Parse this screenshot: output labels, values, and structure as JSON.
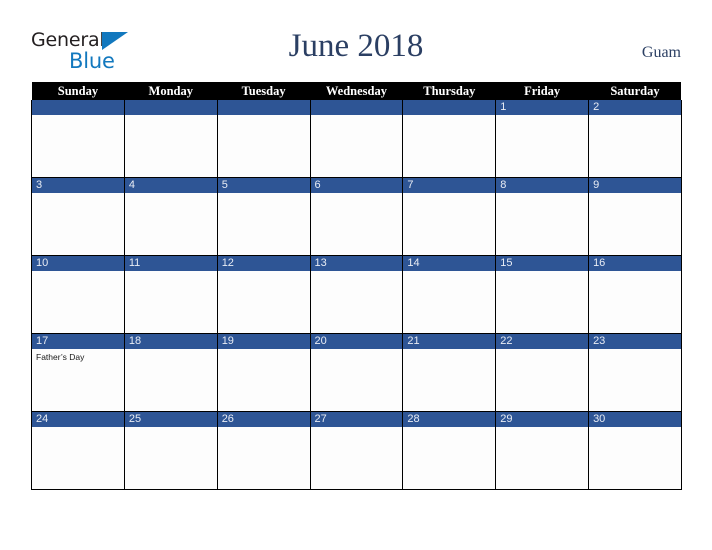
{
  "brand": {
    "word_one": "General",
    "word_two": "Blue",
    "triangle_color": "#1278be",
    "word_one_color": "#231f20",
    "word_two_color": "#1278be"
  },
  "header": {
    "title": "June 2018",
    "locale": "Guam",
    "title_color": "#2b3f63"
  },
  "calendar": {
    "weekday_headers": [
      "Sunday",
      "Monday",
      "Tuesday",
      "Wednesday",
      "Thursday",
      "Friday",
      "Saturday"
    ],
    "header_bg": "#000000",
    "header_text_color": "#ffffff",
    "date_bar_color": "#2e5595",
    "date_text_color": "#e8ecf4",
    "cell_bg": "#fdfdfd",
    "border_color": "#000000",
    "weeks": [
      [
        {
          "date": "",
          "events": []
        },
        {
          "date": "",
          "events": []
        },
        {
          "date": "",
          "events": []
        },
        {
          "date": "",
          "events": []
        },
        {
          "date": "",
          "events": []
        },
        {
          "date": "1",
          "events": []
        },
        {
          "date": "2",
          "events": []
        }
      ],
      [
        {
          "date": "3",
          "events": []
        },
        {
          "date": "4",
          "events": []
        },
        {
          "date": "5",
          "events": []
        },
        {
          "date": "6",
          "events": []
        },
        {
          "date": "7",
          "events": []
        },
        {
          "date": "8",
          "events": []
        },
        {
          "date": "9",
          "events": []
        }
      ],
      [
        {
          "date": "10",
          "events": []
        },
        {
          "date": "11",
          "events": []
        },
        {
          "date": "12",
          "events": []
        },
        {
          "date": "13",
          "events": []
        },
        {
          "date": "14",
          "events": []
        },
        {
          "date": "15",
          "events": []
        },
        {
          "date": "16",
          "events": []
        }
      ],
      [
        {
          "date": "17",
          "events": [
            "Father’s Day"
          ]
        },
        {
          "date": "18",
          "events": []
        },
        {
          "date": "19",
          "events": []
        },
        {
          "date": "20",
          "events": []
        },
        {
          "date": "21",
          "events": []
        },
        {
          "date": "22",
          "events": []
        },
        {
          "date": "23",
          "events": []
        }
      ],
      [
        {
          "date": "24",
          "events": []
        },
        {
          "date": "25",
          "events": []
        },
        {
          "date": "26",
          "events": []
        },
        {
          "date": "27",
          "events": []
        },
        {
          "date": "28",
          "events": []
        },
        {
          "date": "29",
          "events": []
        },
        {
          "date": "30",
          "events": []
        }
      ]
    ]
  }
}
